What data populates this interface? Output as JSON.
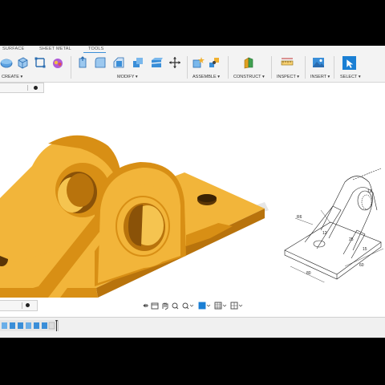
{
  "toolbar": {
    "tabs": {
      "surface": "SURFACE",
      "sheet_metal": "SHEET METAL",
      "tools": "TOOLS"
    },
    "groups": {
      "create": "CREATE",
      "modify": "MODIFY",
      "assemble": "ASSEMBLE",
      "construct": "CONSTRUCT",
      "inspect": "INSPECT",
      "insert": "INSERT",
      "select": "SELECT"
    },
    "dropdown_glyph": "▾"
  },
  "drawing": {
    "labels": {
      "r60": "R6",
      "d1": "25",
      "d2": "15",
      "d3": "12",
      "d4": "60",
      "d5": "80",
      "d6": "12"
    }
  },
  "colors": {
    "part_face": "#f2b53a",
    "part_side": "#d88f15",
    "part_dark": "#b8730c",
    "accent_blue": "#1a7fd4"
  }
}
